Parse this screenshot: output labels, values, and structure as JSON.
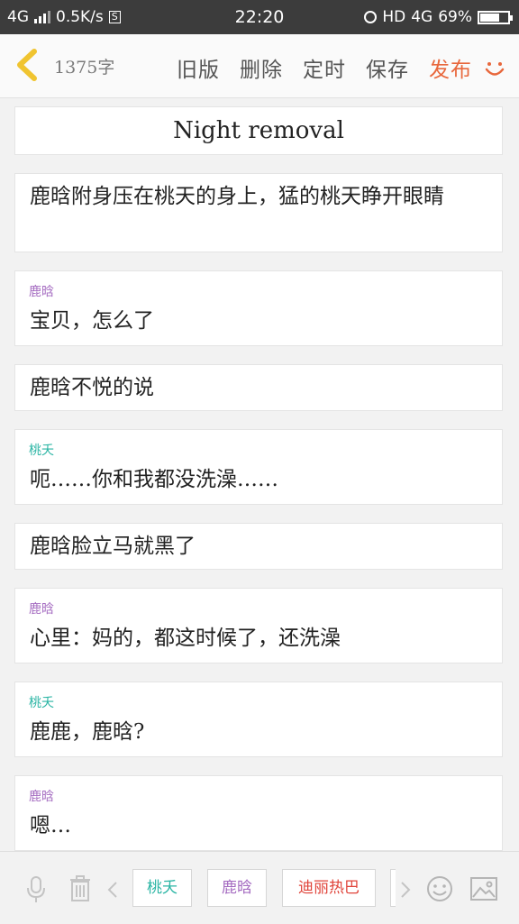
{
  "status_bar": {
    "network": "4G",
    "speed": "0.5K/s",
    "time": "22:20",
    "hd": "HD",
    "net_right": "4G",
    "battery": "69%",
    "battery_level": 0.69
  },
  "toolbar": {
    "word_count": "1375字",
    "old_version": "旧版",
    "delete": "删除",
    "schedule": "定时",
    "save": "保存",
    "publish": "发布",
    "accent_color": "#e8673c"
  },
  "title": "Night removal",
  "cards": [
    {
      "speaker": "",
      "speaker_color": "",
      "text": "鹿晗附身压在桃天的身上，猛的桃天睁开眼睛"
    },
    {
      "speaker": "鹿晗",
      "speaker_color": "#a56cc1",
      "text": "宝贝，怎么了"
    },
    {
      "speaker": "",
      "speaker_color": "",
      "text": "鹿晗不悦的说"
    },
    {
      "speaker": "桃夭",
      "speaker_color": "#2bb5a4",
      "text": "呃……你和我都没洗澡……"
    },
    {
      "speaker": "",
      "speaker_color": "",
      "text": "鹿晗脸立马就黑了"
    },
    {
      "speaker": "鹿晗",
      "speaker_color": "#a56cc1",
      "text": "心里：妈的，都这时候了，还洗澡"
    },
    {
      "speaker": "桃夭",
      "speaker_color": "#2bb5a4",
      "text": "鹿鹿，鹿晗?"
    },
    {
      "speaker": "鹿晗",
      "speaker_color": "#a56cc1",
      "text": "嗯…"
    }
  ],
  "bottom_bar": {
    "icons": [
      "microphone-icon",
      "trash-icon",
      "chevron-left-icon",
      "chevron-right-icon",
      "emoji-icon",
      "image-icon"
    ],
    "chips": [
      {
        "label": "桃夭",
        "color": "#2bb5a4"
      },
      {
        "label": "鹿晗",
        "color": "#a56cc1"
      },
      {
        "label": "迪丽热巴",
        "color": "#e0443a"
      }
    ]
  }
}
